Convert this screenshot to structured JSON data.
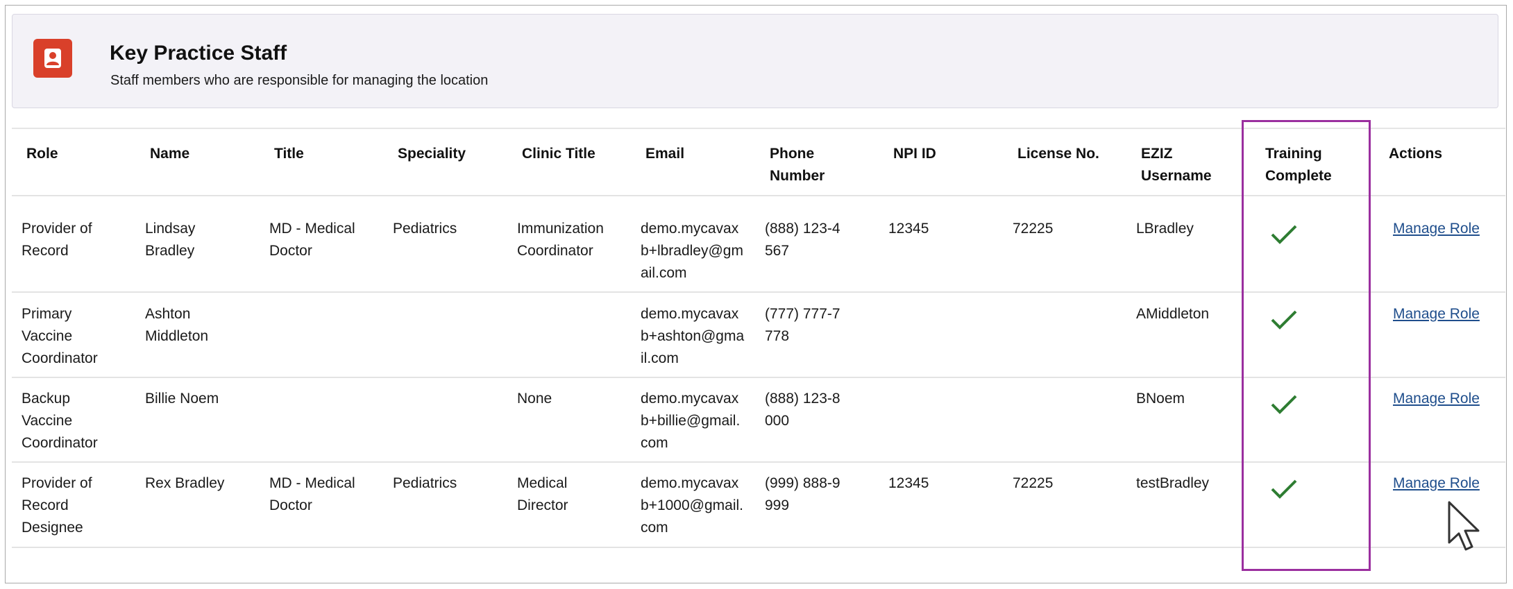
{
  "header": {
    "title": "Key Practice Staff",
    "subtitle": "Staff members who are responsible for managing the location",
    "icon": "person-icon",
    "icon_color": "#d9402a"
  },
  "table": {
    "columns": [
      "Role",
      "Name",
      "Title",
      "Speciality",
      "Clinic Title",
      "Email",
      "Phone Number",
      "NPI ID",
      "License No.",
      "EZIZ Username",
      "Training Complete",
      "Actions"
    ],
    "rows": [
      {
        "role": "Provider of Record",
        "name": "Lindsay Bradley",
        "title": "MD - Medical Doctor",
        "speciality": "Pediatrics",
        "clinic_title": "Immunization Coordinator",
        "email": "demo.mycavaxb+lbradley@gmail.com",
        "phone": "(888) 123-4567",
        "npi": "12345",
        "license": "72225",
        "eziz": "LBradley",
        "training_complete": true,
        "action": "Manage Role"
      },
      {
        "role": "Primary Vaccine Coordinator",
        "name": "Ashton Middleton",
        "title": "",
        "speciality": "",
        "clinic_title": "",
        "email": "demo.mycavaxb+ashton@gmail.com",
        "phone": "(777) 777-7778",
        "npi": "",
        "license": "",
        "eziz": "AMiddleton",
        "training_complete": true,
        "action": "Manage Role"
      },
      {
        "role": "Backup Vaccine Coordinator",
        "name": "Billie Noem",
        "title": "",
        "speciality": "",
        "clinic_title": "None",
        "email": "demo.mycavaxb+billie@gmail.com",
        "phone": "(888) 123-8000",
        "npi": "",
        "license": "",
        "eziz": "BNoem",
        "training_complete": true,
        "action": "Manage Role"
      },
      {
        "role": "Provider of Record Designee",
        "name": "Rex Bradley",
        "title": "MD - Medical Doctor",
        "speciality": "Pediatrics",
        "clinic_title": "Medical Director",
        "email": "demo.mycavaxb+1000@gmail.com",
        "phone": "(999) 888-9999",
        "npi": "12345",
        "license": "72225",
        "eziz": "testBradley",
        "training_complete": true,
        "action": "Manage Role"
      }
    ]
  },
  "colors": {
    "check": "#2e7d32",
    "highlight": "#9b2f9f",
    "link": "#1f4e8c"
  },
  "icons": {
    "check": "checkmark-icon",
    "cursor": "mouse-pointer-icon"
  }
}
